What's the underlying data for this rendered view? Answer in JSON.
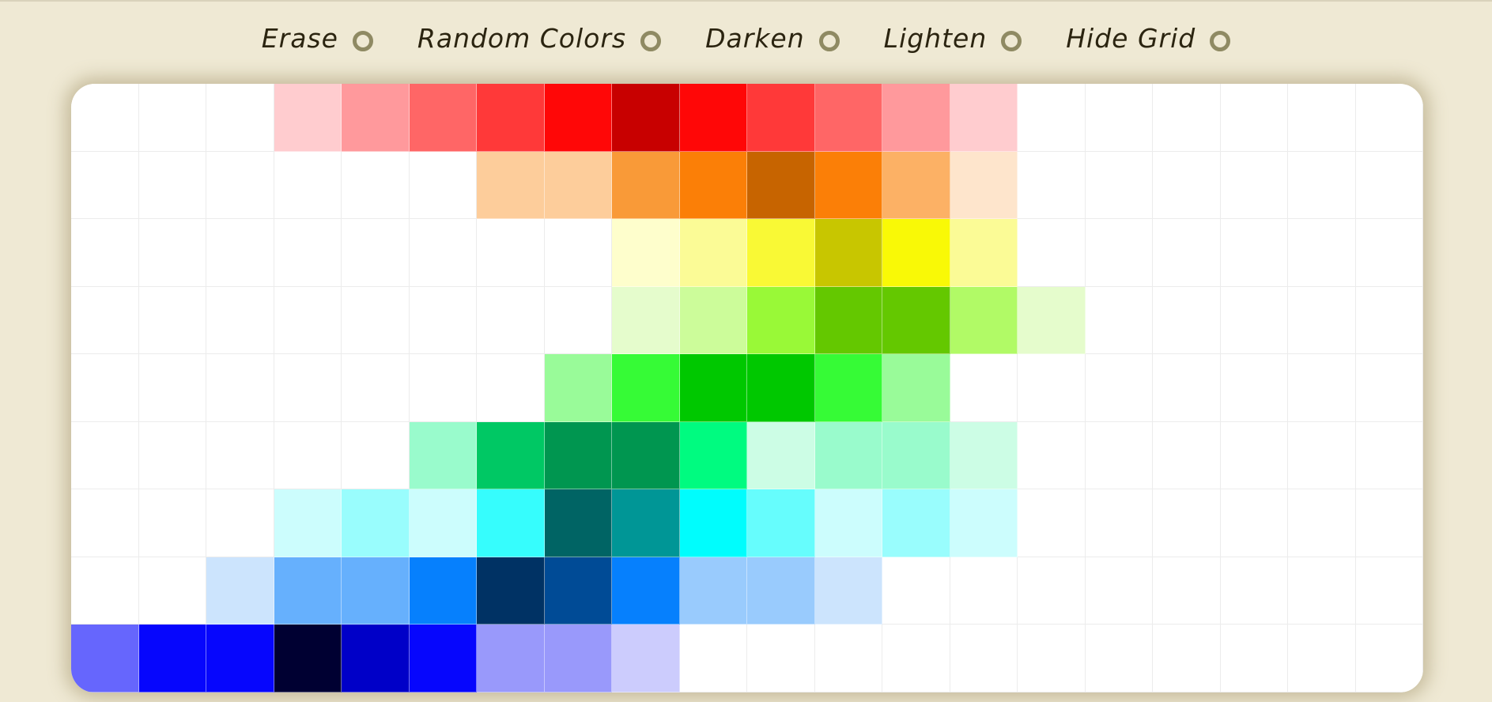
{
  "toolbar": {
    "items": [
      {
        "label": "Erase",
        "name": "erase"
      },
      {
        "label": "Random Colors",
        "name": "random-colors"
      },
      {
        "label": "Darken",
        "name": "darken"
      },
      {
        "label": "Lighten",
        "name": "lighten"
      },
      {
        "label": "Hide Grid",
        "name": "hide-grid"
      }
    ]
  },
  "colors": {
    "background": "#efe9d4",
    "radio_border": "#8f8a63",
    "label_text": "#2b2410",
    "board": "#ffffff"
  },
  "grid": {
    "columns": 20,
    "rows": [
      [
        "#ffffff",
        "#ffffff",
        "#ffffff",
        "#ffcccf",
        "#ff999c",
        "#ff6666",
        "#ff3939",
        "#ff0707",
        "#c80000",
        "#ff0707",
        "#ff3939",
        "#ff6666",
        "#ff999c",
        "#ffcccf",
        "#ffffff",
        "#ffffff",
        "#ffffff",
        "#ffffff",
        "#ffffff",
        "#ffffff"
      ],
      [
        "#ffffff",
        "#ffffff",
        "#ffffff",
        "#ffffff",
        "#ffffff",
        "#ffffff",
        "#fdcd9b",
        "#fdcd9b",
        "#f99a38",
        "#fb7f07",
        "#c76400",
        "#fb7f07",
        "#fcb165",
        "#fee5cc",
        "#ffffff",
        "#ffffff",
        "#ffffff",
        "#ffffff",
        "#ffffff",
        "#ffffff"
      ],
      [
        "#ffffff",
        "#ffffff",
        "#ffffff",
        "#ffffff",
        "#ffffff",
        "#ffffff",
        "#ffffff",
        "#ffffff",
        "#fefecc",
        "#fbfb96",
        "#f9f935",
        "#c8c600",
        "#f9f906",
        "#fbfb96",
        "#ffffff",
        "#ffffff",
        "#ffffff",
        "#ffffff",
        "#ffffff",
        "#ffffff"
      ],
      [
        "#ffffff",
        "#ffffff",
        "#ffffff",
        "#ffffff",
        "#ffffff",
        "#ffffff",
        "#ffffff",
        "#ffffff",
        "#e5fccc",
        "#ccfc9a",
        "#99f937",
        "#64c800",
        "#64c800",
        "#b1fa66",
        "#e5fccc",
        "#ffffff",
        "#ffffff",
        "#ffffff",
        "#ffffff",
        "#ffffff"
      ],
      [
        "#ffffff",
        "#ffffff",
        "#ffffff",
        "#ffffff",
        "#ffffff",
        "#ffffff",
        "#ffffff",
        "#99fb99",
        "#36fb36",
        "#00c800",
        "#00c800",
        "#36fb36",
        "#99fb99",
        "#ffffff",
        "#ffffff",
        "#ffffff",
        "#ffffff",
        "#ffffff",
        "#ffffff",
        "#ffffff"
      ],
      [
        "#ffffff",
        "#ffffff",
        "#ffffff",
        "#ffffff",
        "#ffffff",
        "#99fbcc",
        "#00c864",
        "#009650",
        "#009650",
        "#00fb80",
        "#ccfde5",
        "#99fbcc",
        "#99fbcc",
        "#ccfde5",
        "#ffffff",
        "#ffffff",
        "#ffffff",
        "#ffffff",
        "#ffffff",
        "#ffffff"
      ],
      [
        "#ffffff",
        "#ffffff",
        "#ffffff",
        "#ccfdfd",
        "#99fdfd",
        "#ccfdfd",
        "#36fdfd",
        "#006464",
        "#009696",
        "#00fdfd",
        "#66fdfd",
        "#ccfdfd",
        "#99fdfd",
        "#ccfdfd",
        "#ffffff",
        "#ffffff",
        "#ffffff",
        "#ffffff",
        "#ffffff",
        "#ffffff"
      ],
      [
        "#ffffff",
        "#ffffff",
        "#cce4fd",
        "#66b0fd",
        "#66b0fd",
        "#0680fd",
        "#003264",
        "#004b96",
        "#0680fd",
        "#99cbfd",
        "#99cbfd",
        "#cce4fd",
        "#ffffff",
        "#ffffff",
        "#ffffff",
        "#ffffff",
        "#ffffff",
        "#ffffff",
        "#ffffff",
        "#ffffff"
      ],
      [
        "#6666fd",
        "#0606fd",
        "#0606fd",
        "#000032",
        "#0000c8",
        "#0606fd",
        "#9999fb",
        "#9999fb",
        "#ccccfd",
        "#ffffff",
        "#ffffff",
        "#ffffff",
        "#ffffff",
        "#ffffff",
        "#ffffff",
        "#ffffff",
        "#ffffff",
        "#ffffff",
        "#ffffff",
        "#ffffff"
      ]
    ]
  }
}
